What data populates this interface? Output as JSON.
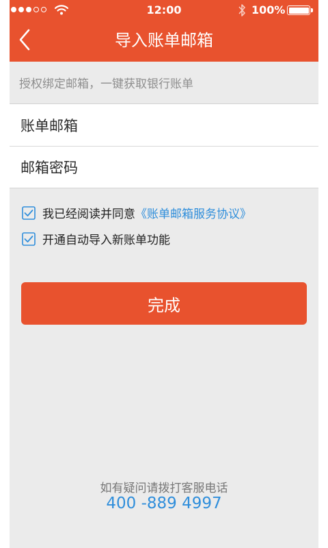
{
  "status_bar": {
    "time": "12:00",
    "battery": "100%",
    "signal_bars_filled": 3,
    "signal_bars_total": 5
  },
  "nav": {
    "title": "导入账单邮箱",
    "back_icon": "chevron-left-icon"
  },
  "hint": "授权绑定邮箱，一键获取银行账单",
  "form": {
    "email_placeholder": "账单邮箱",
    "password_placeholder": "邮箱密码"
  },
  "agreement": {
    "checked": true,
    "prefix": "我已经阅读并同意",
    "link": "《账单邮箱服务协议》"
  },
  "auto_import": {
    "checked": true,
    "label": "开通自动导入新账单功能"
  },
  "submit_label": "完成",
  "help": {
    "text": "如有疑问请拨打客服电话",
    "phone": "400 -889 4997"
  },
  "colors": {
    "brand": "#e8522e",
    "link": "#2f8edb",
    "background": "#ebebeb"
  }
}
